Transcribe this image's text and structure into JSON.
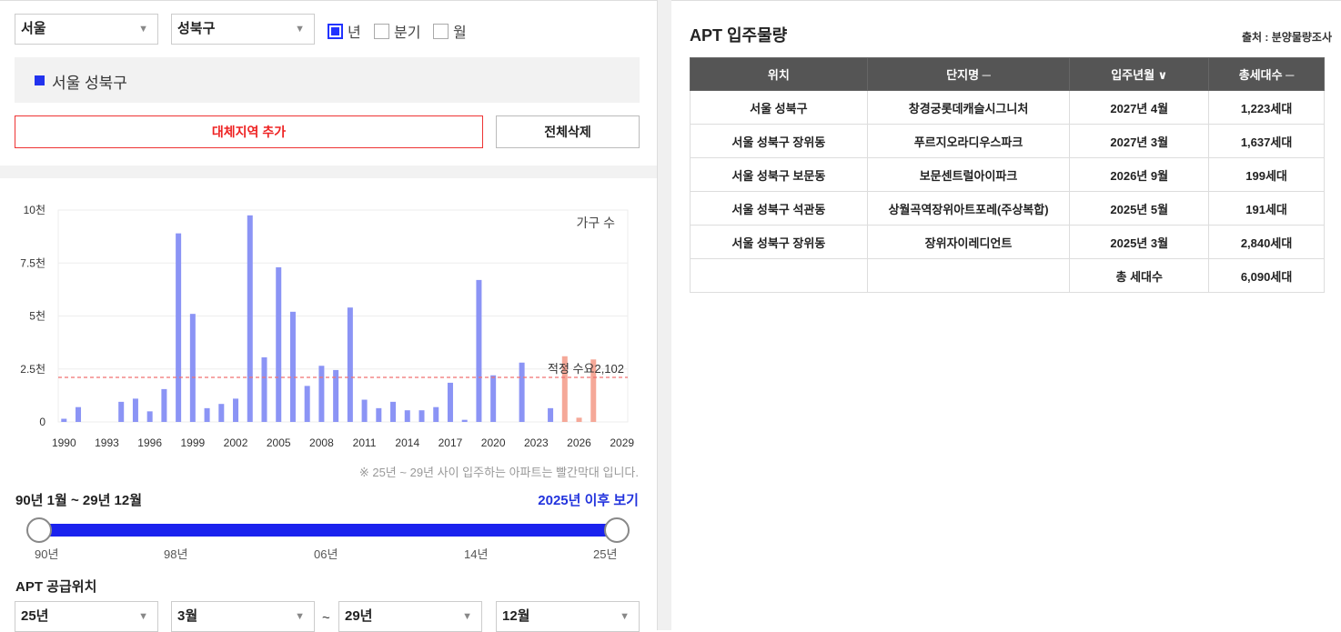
{
  "filters": {
    "city": "서울",
    "district": "성북구",
    "period_options": [
      {
        "label": "년",
        "checked": true
      },
      {
        "label": "분기",
        "checked": false
      },
      {
        "label": "월",
        "checked": false
      }
    ]
  },
  "region_box": {
    "label": "서울 성북구"
  },
  "buttons": {
    "add_region": "대체지역 추가",
    "delete_all": "전체삭제"
  },
  "chart_data": {
    "type": "bar",
    "legend": "가구 수",
    "ylim": [
      0,
      10000
    ],
    "yticks": [
      "0",
      "2.5천",
      "5천",
      "7.5천",
      "10천"
    ],
    "xticks": [
      "1990",
      "1993",
      "1996",
      "1999",
      "2002",
      "2005",
      "2008",
      "2011",
      "2014",
      "2017",
      "2020",
      "2023",
      "2026",
      "2029"
    ],
    "x": [
      1990,
      1991,
      1994,
      1995,
      1996,
      1997,
      1998,
      1999,
      2000,
      2001,
      2002,
      2003,
      2004,
      2005,
      2006,
      2007,
      2008,
      2009,
      2010,
      2011,
      2012,
      2013,
      2014,
      2015,
      2016,
      2017,
      2018,
      2019,
      2020,
      2022,
      2024,
      2025,
      2026,
      2027
    ],
    "values": [
      150,
      700,
      950,
      1100,
      500,
      1550,
      8900,
      5100,
      650,
      850,
      1100,
      9750,
      3050,
      7300,
      5200,
      1700,
      2650,
      2450,
      5400,
      1050,
      650,
      950,
      550,
      550,
      700,
      1850,
      100,
      6700,
      2200,
      2800,
      650,
      3100,
      200,
      2950
    ],
    "highlight_from": 2025,
    "bar_color": "#8b94f5",
    "highlight_color": "#f5a898",
    "reference_line": {
      "label": "적정 수요",
      "value": 2102,
      "value_label": "2,102",
      "color": "#f07070"
    }
  },
  "chart_note": "※ 25년 ~ 29년 사이 입주하는 아파트는 빨간막대 입니다.",
  "range": {
    "title": "90년 1월 ~ 29년 12월",
    "link": "2025년 이후 보기",
    "ticks": [
      "90년",
      "98년",
      "06년",
      "14년",
      "25년"
    ]
  },
  "supply": {
    "title": "APT 공급위치",
    "from_year": "25년",
    "from_month": "3월",
    "tilde": "~",
    "to_year": "29년",
    "to_month": "12월"
  },
  "apt": {
    "title": "APT 입주물량",
    "source": "출처 : 분양물량조사",
    "headers": [
      "위치",
      "단지명 ─",
      "입주년월 ∨",
      "총세대수 ─"
    ],
    "rows": [
      [
        "서울 성북구",
        "창경궁롯데캐슬시그니처",
        "2027년 4월",
        "1,223세대"
      ],
      [
        "서울 성북구 장위동",
        "푸르지오라디우스파크",
        "2027년 3월",
        "1,637세대"
      ],
      [
        "서울 성북구 보문동",
        "보문센트럴아이파크",
        "2026년 9월",
        "199세대"
      ],
      [
        "서울 성북구 석관동",
        "상월곡역장위아트포레(주상복합)",
        "2025년 5월",
        "191세대"
      ],
      [
        "서울 성북구 장위동",
        "장위자이레디언트",
        "2025년 3월",
        "2,840세대"
      ],
      [
        "",
        "",
        "총 세대수",
        "6,090세대"
      ]
    ]
  }
}
